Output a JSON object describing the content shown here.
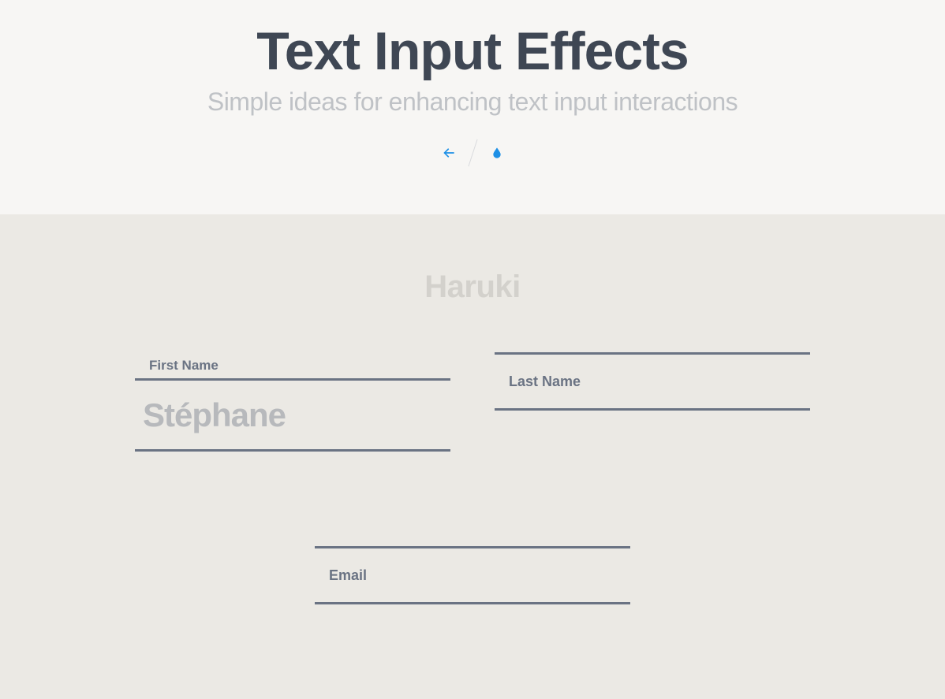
{
  "header": {
    "title": "Text Input Effects",
    "subtitle": "Simple ideas for enhancing text input interactions"
  },
  "nav": {
    "back_icon": "arrow-left",
    "theme_icon": "drop"
  },
  "section": {
    "name": "Haruki",
    "fields": {
      "first_name": {
        "label": "First Name",
        "value": "Stéphane"
      },
      "last_name": {
        "label": "Last Name",
        "value": ""
      },
      "email": {
        "label": "Email",
        "value": ""
      }
    }
  },
  "colors": {
    "accent": "#1e90e6",
    "text_dark": "#3f4754",
    "muted": "#b7b9bc",
    "line": "#6a7383",
    "hero_bg": "#f7f6f4",
    "section_bg": "#ebe9e4"
  }
}
